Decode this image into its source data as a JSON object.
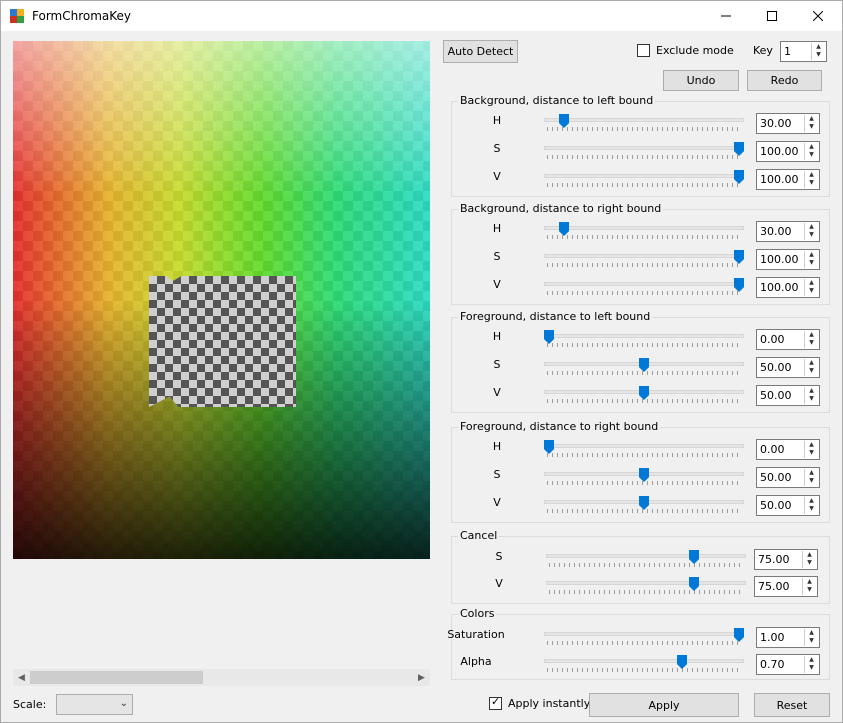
{
  "window": {
    "title": "FormChromaKey"
  },
  "toolbar": {
    "auto_detect": "Auto Detect",
    "exclude_mode": "Exclude mode",
    "key_label": "Key",
    "key_value": "1",
    "undo": "Undo",
    "redo": "Redo"
  },
  "groups": [
    {
      "title": "Background, distance to left bound",
      "rows": [
        {
          "label": "H",
          "value": "30.00",
          "fraction": 0.08
        },
        {
          "label": "S",
          "value": "100.00",
          "fraction": 1.0
        },
        {
          "label": "V",
          "value": "100.00",
          "fraction": 1.0
        }
      ]
    },
    {
      "title": "Background, distance to right bound",
      "rows": [
        {
          "label": "H",
          "value": "30.00",
          "fraction": 0.08
        },
        {
          "label": "S",
          "value": "100.00",
          "fraction": 1.0
        },
        {
          "label": "V",
          "value": "100.00",
          "fraction": 1.0
        }
      ]
    },
    {
      "title": "Foreground, distance to left bound",
      "rows": [
        {
          "label": "H",
          "value": "0.00",
          "fraction": 0.0
        },
        {
          "label": "S",
          "value": "50.00",
          "fraction": 0.5
        },
        {
          "label": "V",
          "value": "50.00",
          "fraction": 0.5
        }
      ]
    },
    {
      "title": "Foreground, distance to right bound",
      "rows": [
        {
          "label": "H",
          "value": "0.00",
          "fraction": 0.0
        },
        {
          "label": "S",
          "value": "50.00",
          "fraction": 0.5
        },
        {
          "label": "V",
          "value": "50.00",
          "fraction": 0.5
        }
      ]
    },
    {
      "title": "Cancel",
      "rows": [
        {
          "label": "S",
          "value": "75.00",
          "fraction": 0.75
        },
        {
          "label": "V",
          "value": "75.00",
          "fraction": 0.75
        }
      ]
    },
    {
      "title": "Colors",
      "rows": [
        {
          "label": "Saturation",
          "value": "1.00",
          "fraction": 1.0
        },
        {
          "label": "Alpha",
          "value": "0.70",
          "fraction": 0.7
        }
      ]
    }
  ],
  "footer": {
    "scale_label": "Scale:",
    "scale_value": "",
    "apply_instantly": "Apply instantly",
    "apply_instantly_checked": true,
    "apply": "Apply",
    "reset": "Reset"
  },
  "colors": {
    "accent": "#0078d7",
    "window_bg": "#f0f0f0"
  },
  "icons": {
    "minimize": "minimize-icon",
    "maximize": "maximize-icon",
    "close": "close-icon",
    "app": "app-icon"
  }
}
